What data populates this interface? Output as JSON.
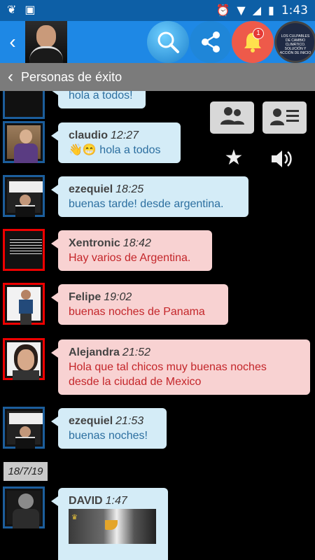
{
  "statusbar": {
    "time": "1:43"
  },
  "header": {
    "title": "Personas de éxito",
    "notifications_count": "1",
    "group_thumb_text": "LOS CULPABLES DE CAMBIO CLIMÁTICO. SOLUCIÓN Y ACCIÓN DE INICIO"
  },
  "messages": [
    {
      "author": "",
      "time": "",
      "text": "hola a todos!",
      "color": "blue"
    },
    {
      "author": "claudio",
      "time": "12:27",
      "emoji": "👋😁",
      "text": "hola a todos",
      "color": "blue"
    },
    {
      "author": "ezequiel",
      "time": "18:25",
      "text": "buenas tarde! desde argentina.",
      "color": "blue"
    },
    {
      "author": "Xentronic",
      "time": "18:42",
      "text": "Hay varios de Argentina.",
      "color": "pink"
    },
    {
      "author": "Felipe",
      "time": "19:02",
      "text": "buenas noches de Panama",
      "color": "pink"
    },
    {
      "author": "Alejandra",
      "time": "21:52",
      "text_line1": "Hola que tal chicos muy buenas noches",
      "text_line2": "desde la ciudad de Mexico",
      "color": "pink"
    },
    {
      "author": "ezequiel",
      "time": "21:53",
      "text": "buenas noches!",
      "color": "blue"
    },
    {
      "author": "DAVID",
      "time": "1:47",
      "text": "",
      "color": "blue"
    }
  ],
  "date_separator": "18/7/19",
  "controls": {
    "star_icon": "star",
    "speaker_icon": "volume"
  }
}
